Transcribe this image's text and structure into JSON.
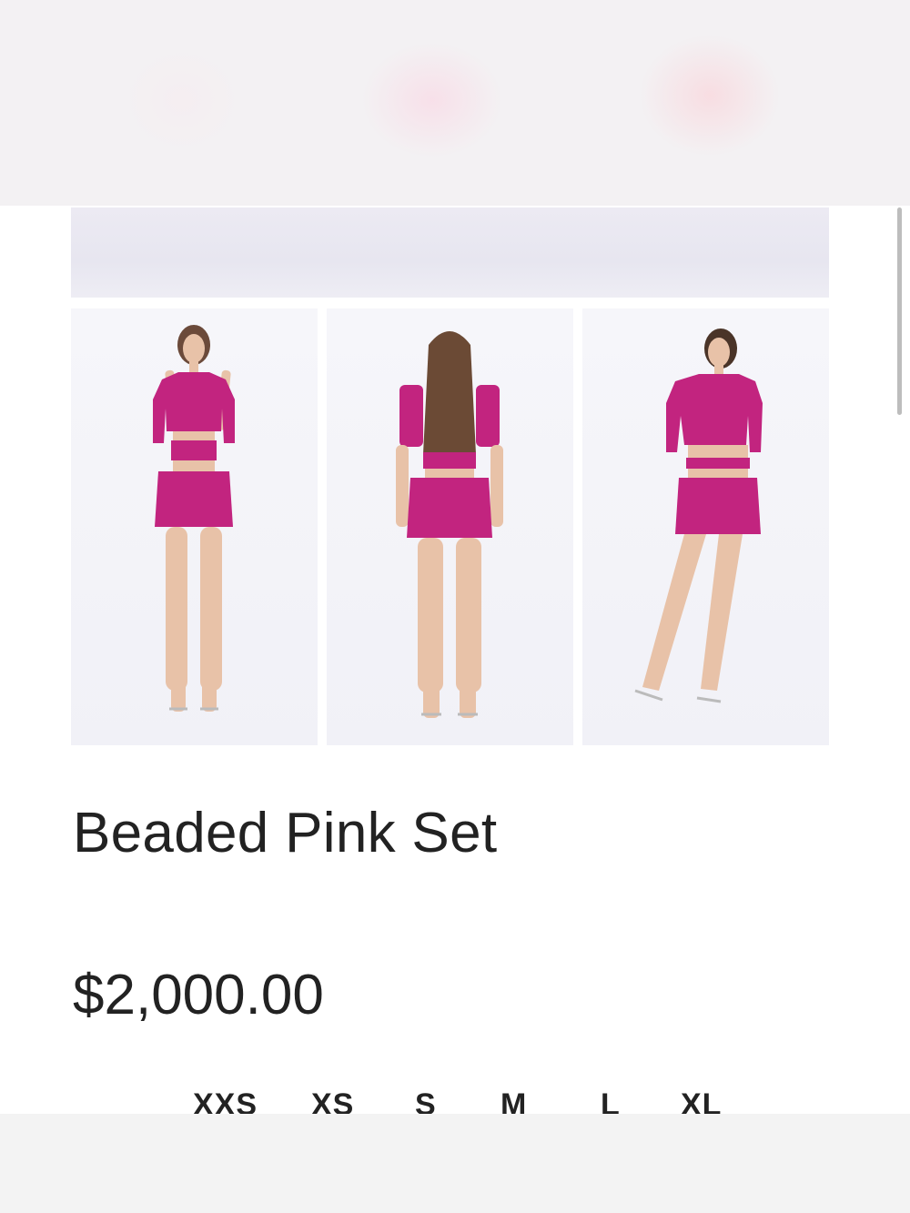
{
  "product": {
    "title": "Beaded Pink Set",
    "price": "$2,000.00"
  },
  "gallery": {
    "images": [
      {
        "name": "front-view"
      },
      {
        "name": "back-view"
      },
      {
        "name": "side-pose-view"
      }
    ]
  },
  "sizes": [
    "XXS",
    "XS",
    "S",
    "M",
    "L",
    "XL"
  ],
  "colors": {
    "sequin_pink": "#c2247f",
    "text": "#222222"
  }
}
